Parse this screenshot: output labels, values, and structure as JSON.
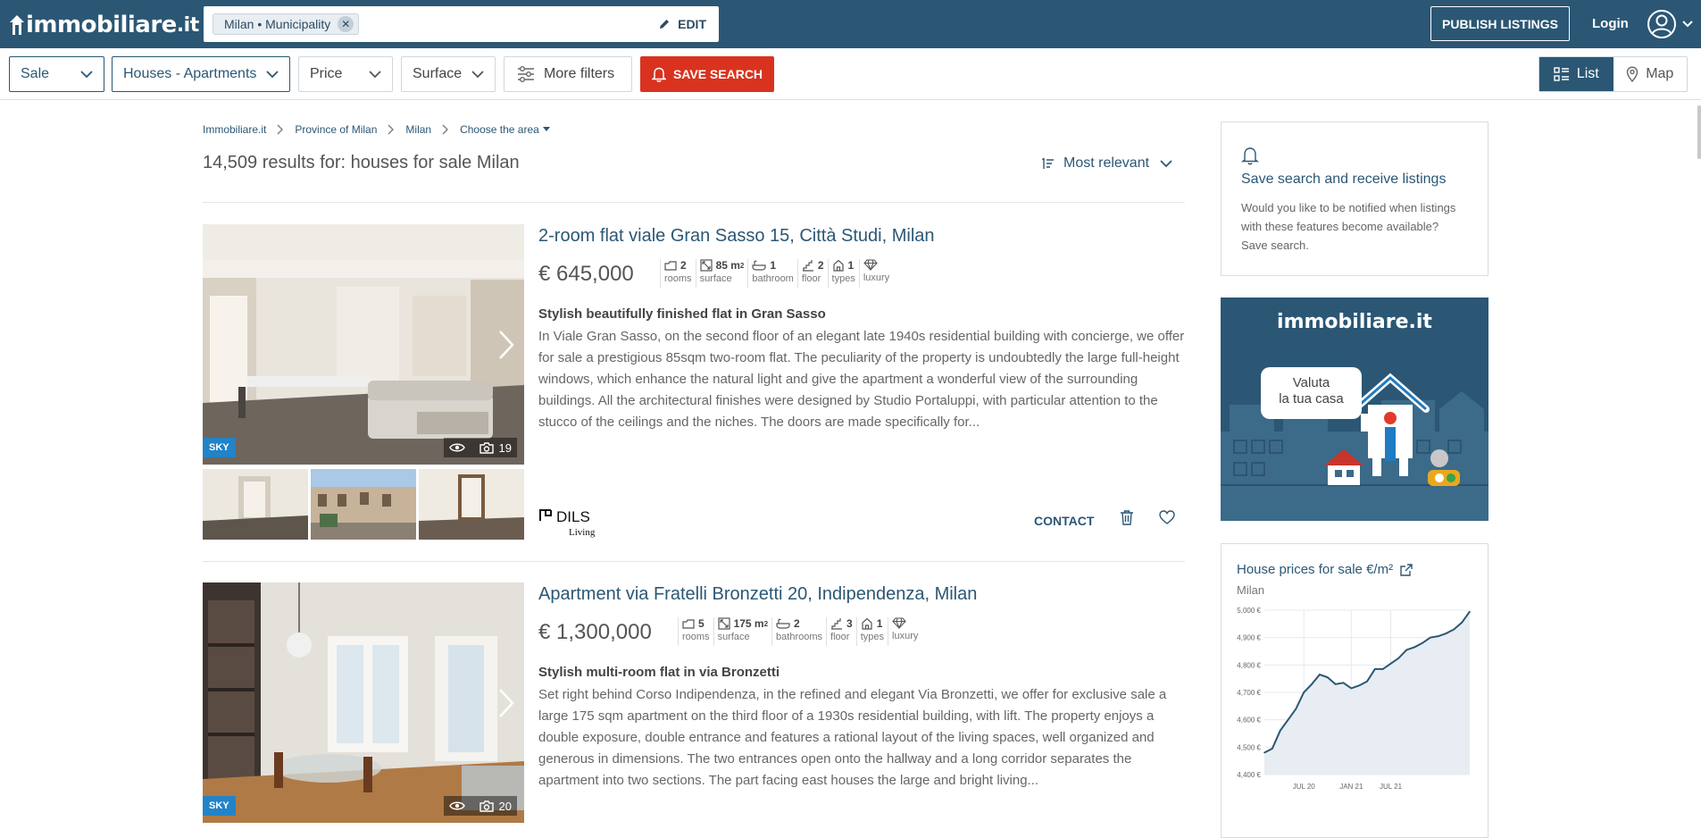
{
  "header": {
    "logo_text": "immobiliare",
    "logo_tld": ".it",
    "search_chip": "Milan • Municipality",
    "edit_label": "EDIT",
    "publish_label": "PUBLISH LISTINGS",
    "login_label": "Login"
  },
  "filters": {
    "contract": "Sale",
    "type": "Houses - Apartments",
    "price": "Price",
    "surface": "Surface",
    "more": "More filters",
    "save_search": "SAVE SEARCH",
    "view_list": "List",
    "view_map": "Map"
  },
  "breadcrumb": [
    "Immobiliare.it",
    "Province of Milan",
    "Milan",
    "Choose the area"
  ],
  "results": {
    "count_text": "14,509 results for: houses for sale Milan",
    "sort_label": "Most relevant"
  },
  "listings": [
    {
      "title": "2-room flat viale Gran Sasso 15, Città Studi, Milan",
      "price": "€ 645,000",
      "features": [
        {
          "value": "2",
          "label": "rooms",
          "icon": "rooms-icon"
        },
        {
          "value": "85 m",
          "unit_sup": "2",
          "label": "surface",
          "icon": "surface-icon"
        },
        {
          "value": "1",
          "label": "bathroom",
          "icon": "bathroom-icon"
        },
        {
          "value": "2",
          "label": "floor",
          "icon": "floor-icon"
        },
        {
          "value": "1",
          "label": "types",
          "icon": "types-icon"
        },
        {
          "value": "",
          "label": "luxury",
          "icon": "luxury-icon"
        }
      ],
      "subtitle": "Stylish beautifully finished flat in Gran Sasso",
      "description": "In Viale Gran Sasso, on the second floor of an elegant late 1940s residential building with concierge, we offer for sale a prestigious 85sqm two-room flat. The peculiarity of the property is undoubtedly the large full-height windows, which enhance the natural light and give the apartment a wonderful view of the surrounding buildings. All the architectural finishes were designed by Studio Portaluppi, with particular attention to the stucco of the ceilings and the niches. The doors are made specifically for...",
      "badge": "SKY",
      "photo_count": "19",
      "agency_name": "DILS",
      "agency_sub": "Living",
      "contact_label": "CONTACT"
    },
    {
      "title": "Apartment via Fratelli Bronzetti 20, Indipendenza, Milan",
      "price": "€ 1,300,000",
      "features": [
        {
          "value": "5",
          "label": "rooms",
          "icon": "rooms-icon"
        },
        {
          "value": "175 m",
          "unit_sup": "2",
          "label": "surface",
          "icon": "surface-icon"
        },
        {
          "value": "2",
          "label": "bathrooms",
          "icon": "bathroom-icon"
        },
        {
          "value": "3",
          "label": "floor",
          "icon": "floor-icon"
        },
        {
          "value": "1",
          "label": "types",
          "icon": "types-icon"
        },
        {
          "value": "",
          "label": "luxury",
          "icon": "luxury-icon"
        }
      ],
      "subtitle": "Stylish multi-room flat in via Bronzetti",
      "description": "Set right behind Corso Indipendenza, in the refined and elegant Via Bronzetti, we offer for exclusive sale a large 175 sqm apartment on the third floor of a 1930s residential building, with lift. The property enjoys a double exposure, double entrance and features a rational layout of the living spaces, well organized and generous in dimensions. The two entrances open onto the hallway and a long corridor separates the apartment into two sections. The part facing east houses the large and bright living...",
      "badge": "SKY",
      "photo_count": "20"
    }
  ],
  "sidebar": {
    "save_title": "Save search and receive listings",
    "save_text": "Would you like to be notified when listings with these features become available? Save search.",
    "ad_logo": "immobiliare.it",
    "ad_bubble_line1": "Valuta",
    "ad_bubble_line2": "la tua casa",
    "prices_title": "House prices for sale €/m²",
    "prices_city": "Milan"
  },
  "chart_data": {
    "type": "line",
    "title": "House prices for sale €/m²",
    "subtitle": "Milan",
    "ylim": [
      4400,
      5000
    ],
    "y_ticks": [
      "4,400 €",
      "4,500 €",
      "4,600 €",
      "4,700 €",
      "4,800 €",
      "4,900 €",
      "5,000 €"
    ],
    "x_ticks": [
      "JUL 20",
      "JAN 21",
      "JUL 21"
    ],
    "series": [
      {
        "values": [
          4480,
          4495,
          4560,
          4600,
          4640,
          4700,
          4730,
          4765,
          4755,
          4730,
          4735,
          4715,
          4725,
          4740,
          4785,
          4785,
          4805,
          4825,
          4855,
          4865,
          4880,
          4900,
          4905,
          4915,
          4930,
          4955,
          4995
        ]
      }
    ],
    "x_tick_index": [
      5,
      11,
      16
    ],
    "grid": true
  },
  "colors": {
    "brand": "#2b5775",
    "accent_red": "#d9331f",
    "badge_blue": "#2283c8"
  }
}
